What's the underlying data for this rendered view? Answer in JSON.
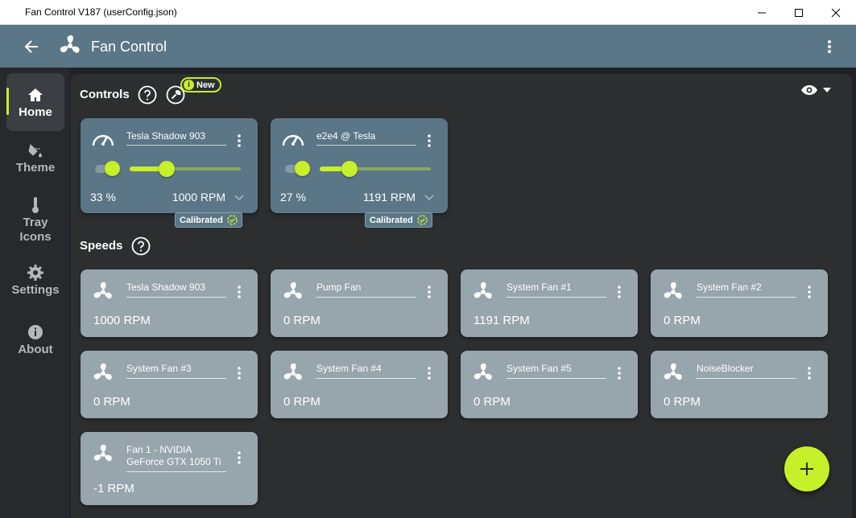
{
  "window": {
    "title": "Fan Control V187 (userConfig.json)",
    "controls": [
      "minimize",
      "maximize",
      "close"
    ]
  },
  "appbar": {
    "title": "Fan Control",
    "icons": [
      "back-arrow-icon",
      "fan-logo-icon",
      "more-vertical-icon"
    ]
  },
  "nav": {
    "items": [
      {
        "label": "Home",
        "icon": "home-icon",
        "active": true
      },
      {
        "label": "Theme",
        "icon": "paint-bucket-icon"
      },
      {
        "label": "Tray Icons",
        "icon": "thermometer-icon"
      },
      {
        "label": "Settings",
        "icon": "gear-icon"
      },
      {
        "label": "About",
        "icon": "info-icon"
      }
    ]
  },
  "controls_section": {
    "label": "Controls",
    "new_badge": "New",
    "cards": [
      {
        "name": "Tesla Shadow 903",
        "percent": "33 %",
        "rpm": "1000 RPM",
        "level": 0.33,
        "badge": "Calibrated"
      },
      {
        "name": "e2e4 @ Tesla",
        "percent": "27 %",
        "rpm": "1191 RPM",
        "level": 0.27,
        "badge": "Calibrated"
      }
    ]
  },
  "speeds_section": {
    "label": "Speeds",
    "cards": [
      {
        "name": "Tesla Shadow 903",
        "rpm": "1000 RPM"
      },
      {
        "name": "Pump Fan",
        "rpm": "0 RPM"
      },
      {
        "name": "System Fan #1",
        "rpm": "1191 RPM"
      },
      {
        "name": "System Fan #2",
        "rpm": "0 RPM"
      },
      {
        "name": "System Fan #3",
        "rpm": "0 RPM"
      },
      {
        "name": "System Fan #4",
        "rpm": "0 RPM"
      },
      {
        "name": "System Fan #5",
        "rpm": "0 RPM"
      },
      {
        "name": "NoiseBlocker",
        "rpm": "0 RPM"
      },
      {
        "name": "Fan 1 - NVIDIA GeForce GTX 1050 Ti",
        "rpm": "-1 RPM"
      }
    ]
  },
  "colors": {
    "accent": "#c6f02a",
    "appbar": "#5b7686",
    "control_card": "#5b7686",
    "speed_card": "#97a5ad",
    "background": "#2c2e30"
  }
}
